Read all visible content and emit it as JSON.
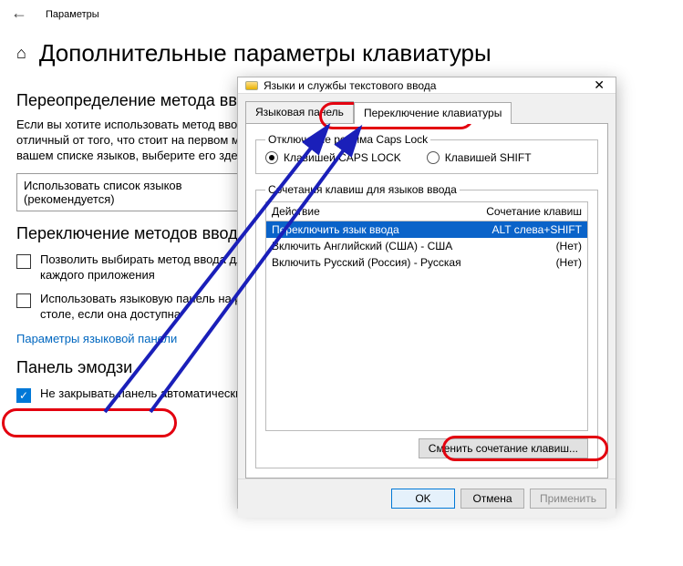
{
  "header": {
    "back_tooltip": "Назад",
    "window_title": "Параметры"
  },
  "page": {
    "title": "Дополнительные параметры клавиатуры",
    "section1_title": "Переопределение метода ввода по умолчанию",
    "section1_desc": "Если вы хотите использовать метод ввода, отличный от того, что стоит на первом месте в вашем списке языков, выберите его здесь",
    "combo_value": "Использовать список языков (рекомендуется)",
    "section2_title": "Переключение методов ввода",
    "check1_label": "Позволить выбирать метод ввода для каждого приложения",
    "check2_label": "Использовать языковую панель на рабочем столе, если она доступна",
    "link_langbar": "Параметры языковой панели",
    "section3_title": "Панель эмодзи",
    "check3_label": "Не закрывать панель автоматически после ввода эмодзи"
  },
  "dialog": {
    "title": "Языки и службы текстового ввода",
    "tab_lang_panel": "Языковая панель",
    "tab_keys": "Переключение клавиатуры",
    "capslock_legend": "Отключение режима Caps Lock",
    "radio_caps": "Клавишей CAPS LOCK",
    "radio_shift": "Клавишей SHIFT",
    "hotkeys_legend": "Сочетания клавиш для языков ввода",
    "col_action": "Действие",
    "col_keys": "Сочетание клавиш",
    "rows": [
      {
        "action": "Переключить язык ввода",
        "keys": "ALT слева+SHIFT",
        "selected": true
      },
      {
        "action": "Включить Английский (США) - США",
        "keys": "(Нет)",
        "selected": false
      },
      {
        "action": "Включить Русский (Россия) - Русская",
        "keys": "(Нет)",
        "selected": false
      }
    ],
    "change_btn": "Сменить сочетание клавиш...",
    "ok": "OK",
    "cancel": "Отмена",
    "apply": "Применить"
  }
}
